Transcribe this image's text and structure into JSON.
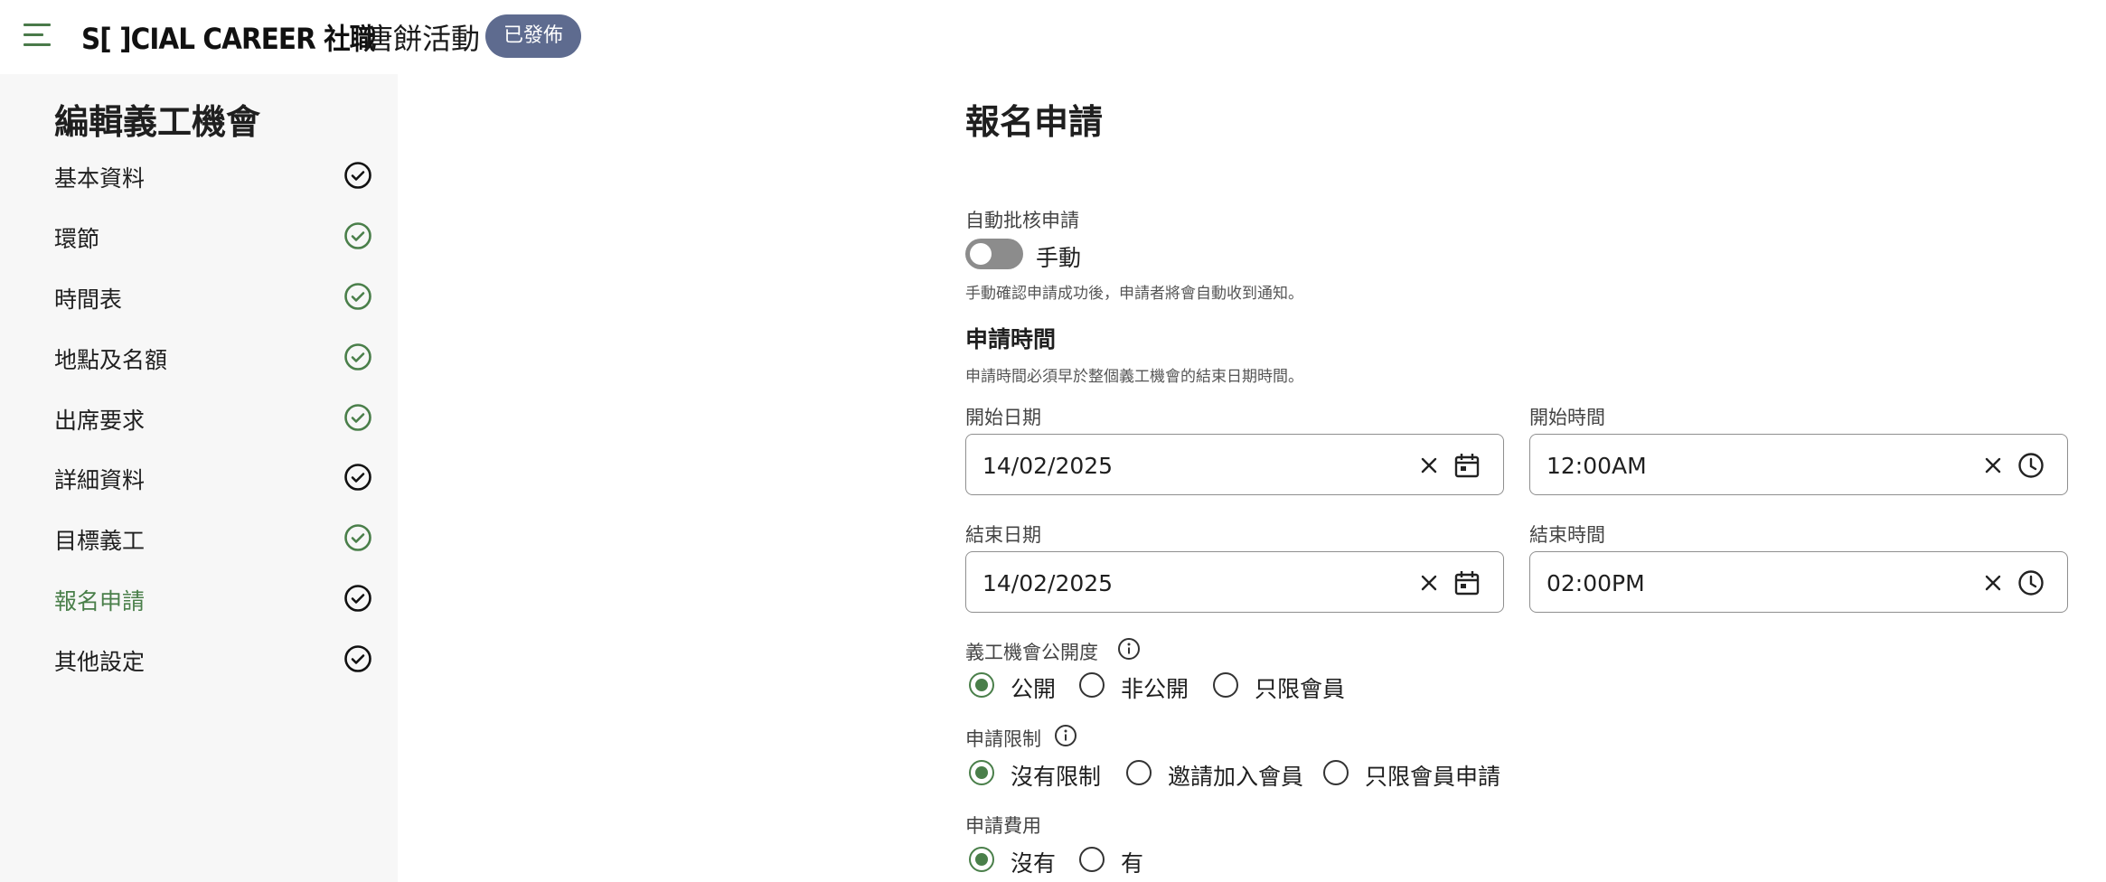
{
  "header": {
    "logo_text": "S[ ]CIAL CAREER 社職",
    "event_title": "唐餅活動",
    "status_badge": "已發佈"
  },
  "sidebar": {
    "title": "編輯義工機會",
    "items": [
      {
        "label": "基本資料",
        "status": "done-dark",
        "active": false
      },
      {
        "label": "環節",
        "status": "done-green",
        "active": false
      },
      {
        "label": "時間表",
        "status": "done-green",
        "active": false
      },
      {
        "label": "地點及名額",
        "status": "done-green",
        "active": false
      },
      {
        "label": "出席要求",
        "status": "done-green",
        "active": false
      },
      {
        "label": "詳細資料",
        "status": "done-dark",
        "active": false
      },
      {
        "label": "目標義工",
        "status": "done-green",
        "active": false
      },
      {
        "label": "報名申請",
        "status": "done-dark",
        "active": true
      },
      {
        "label": "其他設定",
        "status": "done-dark",
        "active": false
      }
    ]
  },
  "main": {
    "title": "報名申請",
    "auto_approve": {
      "label": "自動批核申請",
      "toggle_text": "手動",
      "enabled": false,
      "helper": "手動確認申請成功後，申請者將會自動收到通知。"
    },
    "application_period": {
      "title": "申請時間",
      "helper": "申請時間必須早於整個義工機會的結束日期時間。",
      "start_date": {
        "label": "開始日期",
        "value": "14/02/2025"
      },
      "start_time": {
        "label": "開始時間",
        "value": "12:00AM"
      },
      "end_date": {
        "label": "結束日期",
        "value": "14/02/2025"
      },
      "end_time": {
        "label": "結束時間",
        "value": "02:00PM"
      }
    },
    "visibility": {
      "label": "義工機會公開度",
      "options": [
        "公開",
        "非公開",
        "只限會員"
      ],
      "selected": 0
    },
    "restriction": {
      "label": "申請限制",
      "options": [
        "沒有限制",
        "邀請加入會員",
        "只限會員申請"
      ],
      "selected": 0
    },
    "fee": {
      "label": "申請費用",
      "options": [
        "沒有",
        "有"
      ],
      "selected": 0
    }
  },
  "colors": {
    "accent_green": "#4a7f4a",
    "badge_bg": "#5e6b8f",
    "sidebar_bg": "#f7f7f7",
    "toggle_off": "#8c8c8c"
  }
}
